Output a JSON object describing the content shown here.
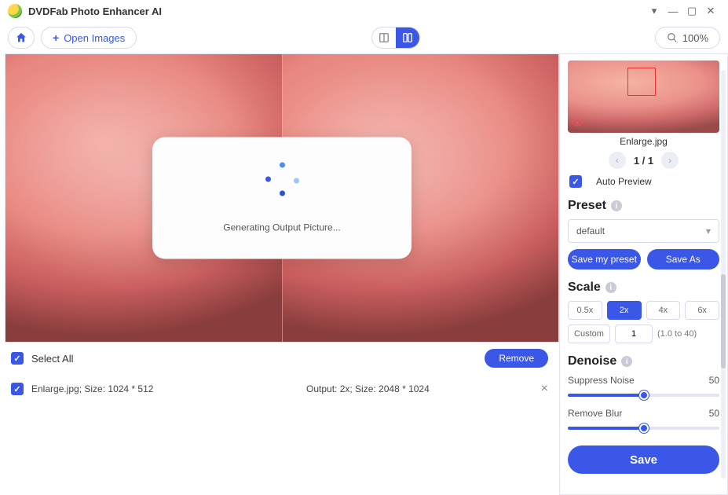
{
  "app": {
    "title": "DVDFab Photo Enhancer AI"
  },
  "toolbar": {
    "open_label": "Open Images",
    "zoom_label": "100%"
  },
  "modal": {
    "text": "Generating Output Picture..."
  },
  "list": {
    "select_all_label": "Select All",
    "remove_label": "Remove",
    "row": {
      "name_size": "Enlarge.jpg; Size: 1024 * 512",
      "output": "Output: 2x; Size: 2048 * 1024"
    }
  },
  "side": {
    "filename": "Enlarge.jpg",
    "page": "1 / 1",
    "auto_preview_label": "Auto Preview",
    "preset": {
      "title": "Preset",
      "selected": "default",
      "save_my": "Save my preset",
      "save_as": "Save As"
    },
    "scale": {
      "title": "Scale",
      "opts": [
        "0.5x",
        "2x",
        "4x",
        "6x"
      ],
      "active": "2x",
      "custom_label": "Custom",
      "custom_value": "1",
      "range_label": "(1.0 to 40)"
    },
    "denoise": {
      "title": "Denoise",
      "suppress_label": "Suppress Noise",
      "suppress_value": "50",
      "blur_label": "Remove Blur",
      "blur_value": "50"
    },
    "save_label": "Save"
  }
}
